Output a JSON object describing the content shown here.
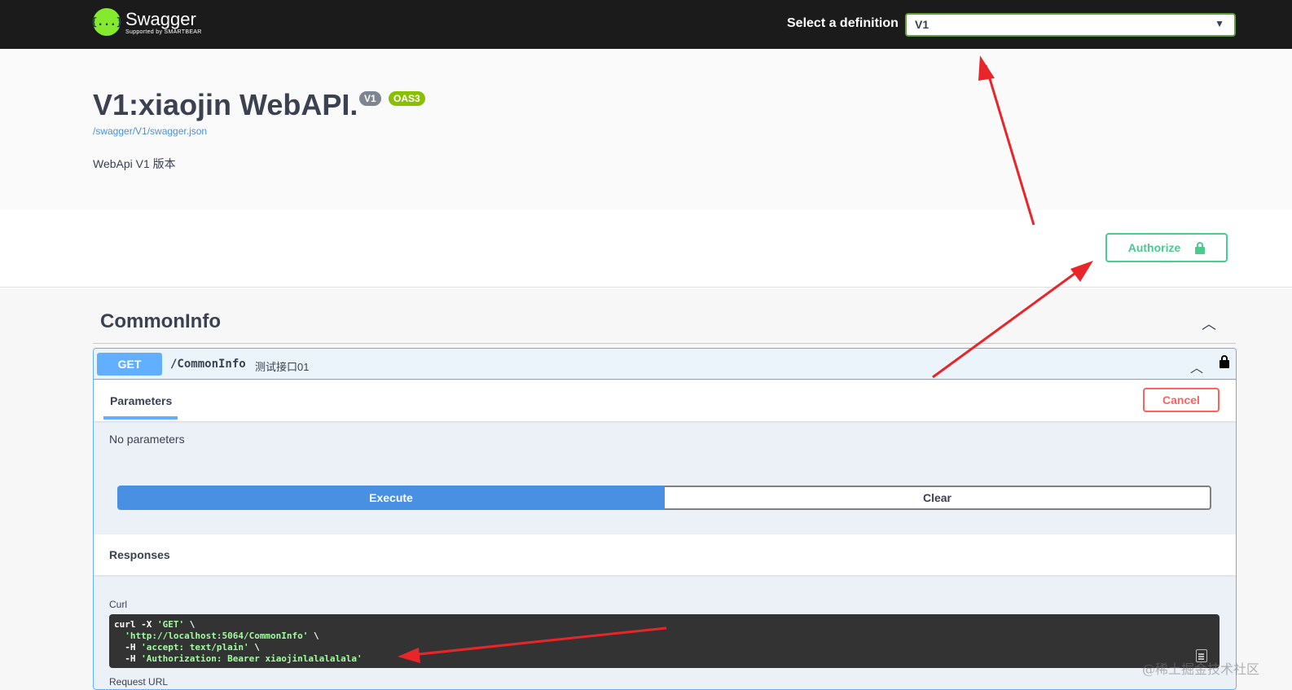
{
  "topbar": {
    "logo_icon": "{...}",
    "logo_name": "Swagger",
    "logo_sub": "Supported by SMARTBEAR",
    "definition_label": "Select a definition",
    "definition_value": "V1"
  },
  "info": {
    "title": "V1:xiaojin WebAPI.",
    "version_badge": "V1",
    "oas_badge": "OAS3",
    "spec_url": "/swagger/V1/swagger.json",
    "description": "WebApi V1 版本"
  },
  "scheme": {
    "authorize_label": "Authorize"
  },
  "tag": {
    "name": "CommonInfo",
    "toggle_glyph": "︿"
  },
  "operation": {
    "method": "GET",
    "path": "/CommonInfo",
    "summary": "测试接口01",
    "toggle_glyph": "︿",
    "parameters_tab": "Parameters",
    "cancel_label": "Cancel",
    "no_params": "No parameters",
    "execute_label": "Execute",
    "clear_label": "Clear",
    "responses_title": "Responses",
    "curl_label": "Curl",
    "curl_lines": {
      "l1_cmd": "curl -X ",
      "l1_str": "'GET'",
      "l1_end": " \\",
      "l2_str": "'http://localhost:5064/CommonInfo'",
      "l2_end": " \\",
      "l3_cmd": "-H ",
      "l3_str": "'accept: text/plain'",
      "l3_end": " \\",
      "l4_cmd": "-H ",
      "l4_str": "'Authorization: Bearer xiaojinlalalalala'"
    },
    "request_url_label": "Request URL"
  },
  "watermark": "@稀土掘金技术社区",
  "colors": {
    "topbar": "#1b1b1b",
    "get": "#61affe",
    "authorize": "#49cc90",
    "cancel": "#ff6060",
    "execute": "#4990e2",
    "annotation_arrow": "#e8262a"
  }
}
